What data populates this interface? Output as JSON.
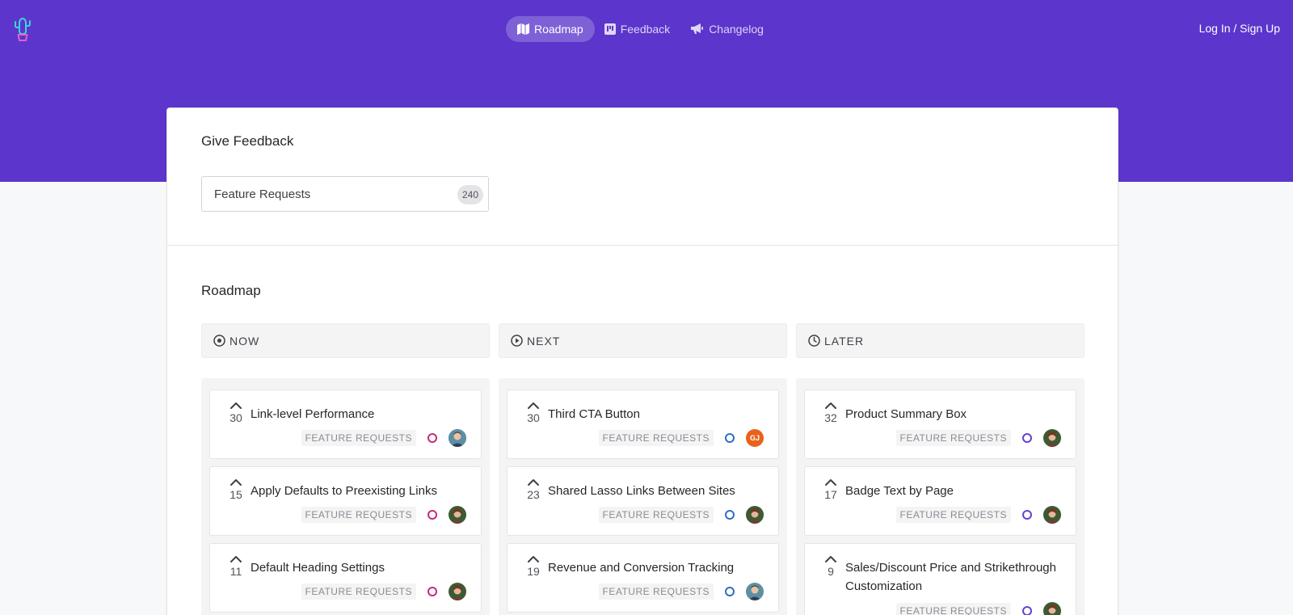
{
  "nav": {
    "logo_icon": "cactus-logo-icon",
    "links": [
      {
        "label": "Roadmap",
        "icon": "map-icon",
        "active": true
      },
      {
        "label": "Feedback",
        "icon": "board-icon",
        "active": false
      },
      {
        "label": "Changelog",
        "icon": "megaphone-icon",
        "active": false
      }
    ],
    "login_label": "Log In / Sign Up"
  },
  "feedback": {
    "title": "Give Feedback",
    "board_name": "Feature Requests",
    "board_count": "240"
  },
  "roadmap": {
    "title": "Roadmap",
    "columns": [
      {
        "label": "NOW",
        "icon": "target-icon",
        "status_color": "#c62a7c",
        "posts": [
          {
            "votes": "30",
            "title": "Link-level Performance",
            "tag": "FEATURE REQUESTS",
            "avatar": "photo-blue"
          },
          {
            "votes": "15",
            "title": "Apply Defaults to Preexisting Links",
            "tag": "FEATURE REQUESTS",
            "avatar": "photo-green"
          },
          {
            "votes": "11",
            "title": "Default Heading Settings",
            "tag": "FEATURE REQUESTS",
            "avatar": "photo-green"
          }
        ]
      },
      {
        "label": "NEXT",
        "icon": "play-icon",
        "status_color": "#2f6fc0",
        "posts": [
          {
            "votes": "30",
            "title": "Third CTA Button",
            "tag": "FEATURE REQUESTS",
            "avatar": "initials",
            "initials": "GJ"
          },
          {
            "votes": "23",
            "title": "Shared Lasso Links Between Sites",
            "tag": "FEATURE REQUESTS",
            "avatar": "photo-green"
          },
          {
            "votes": "19",
            "title": "Revenue and Conversion Tracking",
            "tag": "FEATURE REQUESTS",
            "avatar": "photo-blue"
          }
        ]
      },
      {
        "label": "LATER",
        "icon": "clock-icon",
        "status_color": "#6a3fd1",
        "posts": [
          {
            "votes": "32",
            "title": "Product Summary Box",
            "tag": "FEATURE REQUESTS",
            "avatar": "photo-green"
          },
          {
            "votes": "17",
            "title": "Badge Text by Page",
            "tag": "FEATURE REQUESTS",
            "avatar": "photo-green"
          },
          {
            "votes": "9",
            "title": "Sales/Discount Price and Strikethrough Customization",
            "tag": "FEATURE REQUESTS",
            "avatar": "photo-green"
          }
        ]
      }
    ]
  },
  "colors": {
    "brand": "#5c35cc",
    "initials_avatar": "#e8621c"
  }
}
